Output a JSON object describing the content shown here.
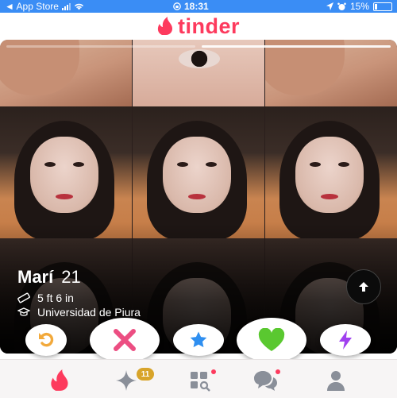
{
  "status_bar": {
    "carrier": "◄ App Store",
    "time": "18:31",
    "battery": "15%"
  },
  "header": {
    "logo_text": "tinder"
  },
  "profile": {
    "name": "Marí",
    "age": "21",
    "height": "5 ft 6 in",
    "school": "Universidad de Piura",
    "photo_count": 2,
    "active_photo": 2
  },
  "actions": {
    "rewind": "rewind-icon",
    "nope": "x-icon",
    "super_like": "star-icon",
    "like": "heart-icon",
    "boost": "lightning-icon"
  },
  "nav": {
    "items": [
      "flame-icon",
      "sparkle-icon",
      "grid-icon",
      "chat-icon",
      "profile-icon"
    ],
    "sparkle_badge": "11"
  },
  "colors": {
    "brand": "#fd3a5d",
    "status_bar": "#3a8df5",
    "rewind": "#f2a93b",
    "nope": "#ec4e82",
    "super_like": "#2f8ff0",
    "like": "#5ac830",
    "boost": "#a040ef"
  }
}
